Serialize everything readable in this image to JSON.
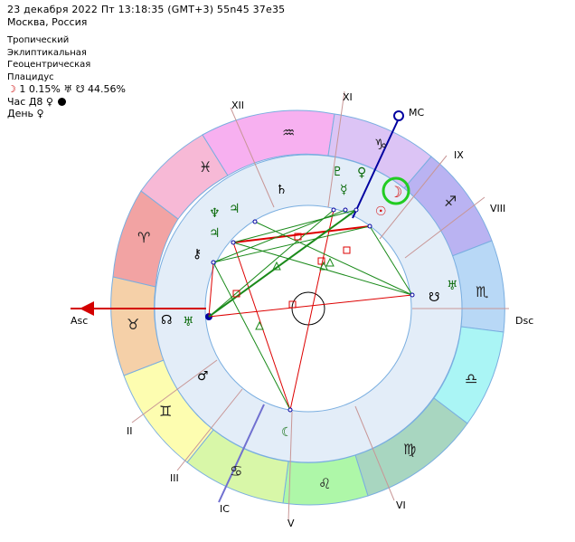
{
  "header": {
    "datetime": "23 декабря 2022  Пт  13:18:35 (GMT+3) 55n45  37e35",
    "location": "Москва, Россия"
  },
  "settings": [
    "Тропический",
    "Эклиптикальная",
    "Геоцентрическая",
    "Плацидус"
  ],
  "moon_phase": {
    "symbol": "☽",
    "day": "1",
    "percent": "0.15%",
    "extra": "44.56%"
  },
  "hour_line": {
    "label": "Час Д8",
    "planet": "♀"
  },
  "day_line": {
    "label": "День",
    "planet": "♀"
  },
  "houses": {
    "cusp_labels": [
      "XII",
      "XI",
      "IX",
      "VIII",
      "II",
      "III",
      "IC",
      "V",
      "VI",
      "MC",
      "Asc",
      "Dsc"
    ]
  },
  "colors": {
    "sign_fire": "#f2a3a3",
    "sign_earth": "#f5d0a8",
    "sign_air": "#fdfdb0",
    "sign_water": "#d8f7a8",
    "house_bg": "#e3edf8",
    "inner_bg": "#ffffff",
    "aspect_red": "#dd0000",
    "aspect_green": "#1a8a1a"
  }
}
